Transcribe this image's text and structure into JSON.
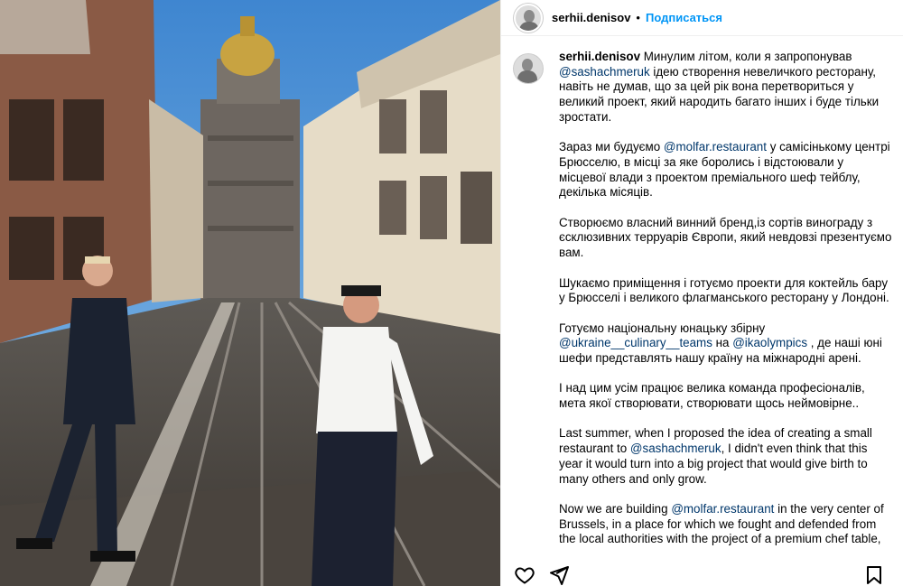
{
  "post": {
    "username": "serhii.denisov",
    "separator": "•",
    "follow_label": "Подписаться"
  },
  "caption": {
    "username": "serhii.denisov",
    "paragraphs": [
      [
        {
          "t": "Минулим літом, коли я запропонував "
        },
        {
          "t": "@sashachmeruk",
          "m": true
        },
        {
          "t": " ідею створення невеличкого ресторану, навіть не думав, що за цей рік вона перетвориться у великий проект, який народить багато інших і буде тільки зростати."
        }
      ],
      [
        {
          "t": "Зараз ми будуємо "
        },
        {
          "t": "@molfar.restaurant",
          "m": true
        },
        {
          "t": " у самісінькому центрі Брюсселю, в місці за яке боролись і відстоювали у місцевої влади з проектом преміального шеф тейблу, декілька місяців."
        }
      ],
      [
        {
          "t": "Створюємо власний винний бренд,із сортів винограду з єсклюзивних терруарів Європи, який невдовзі презентуємо вам."
        }
      ],
      [
        {
          "t": "Шукаємо приміщення і готуємо проекти для коктейль бару у Брюсселі і великого флагманського ресторану у Лондоні."
        }
      ],
      [
        {
          "t": "Готуємо національну юнацьку збірну "
        },
        {
          "t": "@ukraine__culinary__teams",
          "m": true
        },
        {
          "t": " на "
        },
        {
          "t": "@ikaolympics",
          "m": true
        },
        {
          "t": " , де наші юні шефи представлять нашу країну на міжнародні арені."
        }
      ],
      [
        {
          "t": "І над цим усім працює велика команда професіоналів, мета якої створювати, створювати щось неймовірне.."
        }
      ],
      [
        {
          "t": "Last summer, when I proposed the idea of creating a small restaurant to "
        },
        {
          "t": "@sashachmeruk",
          "m": true
        },
        {
          "t": ", I didn't even think that this year it would turn into a big project that would give birth to many others and only grow."
        }
      ],
      [
        {
          "t": "Now we are building "
        },
        {
          "t": "@molfar.restaurant",
          "m": true
        },
        {
          "t": " in the very center of Brussels, in a place for which we fought and defended from the local authorities with the project of a premium chef table,"
        }
      ]
    ]
  },
  "icons": {
    "like": "heart-icon",
    "share": "send-icon",
    "save": "bookmark-icon"
  },
  "colors": {
    "follow": "#0095f6",
    "mention": "#00376b"
  }
}
